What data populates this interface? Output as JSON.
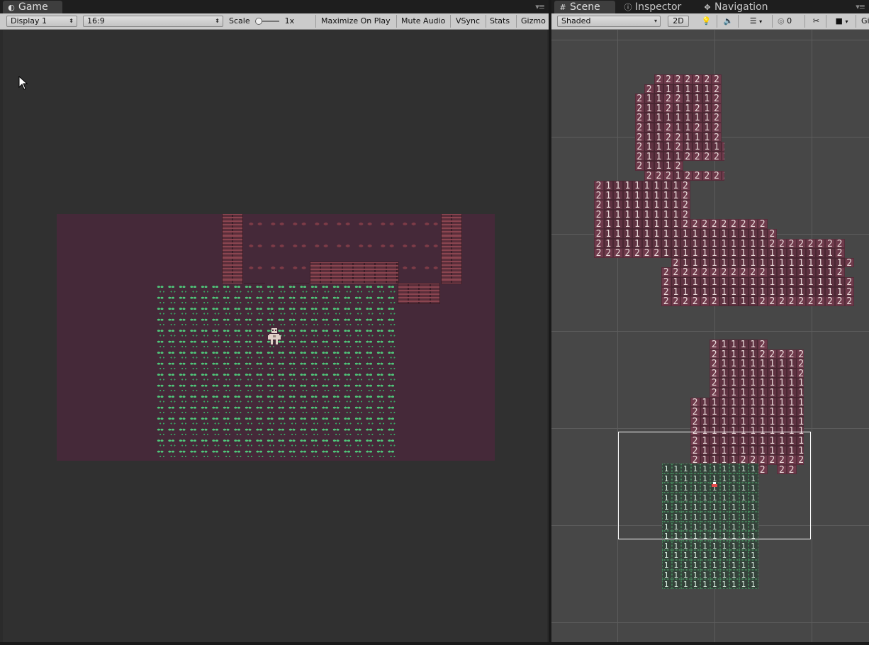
{
  "game_panel": {
    "tab_label": "Game",
    "toolbar": {
      "display": "Display 1",
      "aspect": "16:9",
      "scale_label": "Scale",
      "scale_value": "1x",
      "maximize": "Maximize On Play",
      "mute": "Mute Audio",
      "vsync": "VSync",
      "stats": "Stats",
      "gizmos": "Gizmo"
    }
  },
  "scene_panel": {
    "tabs": [
      {
        "label": "Scene",
        "icon": "hash-icon"
      },
      {
        "label": "Inspector",
        "icon": "info-icon"
      },
      {
        "label": "Navigation",
        "icon": "navigation-icon"
      }
    ],
    "toolbar": {
      "shading": "Shaded",
      "mode_2d": "2D",
      "hidden_count": "0",
      "gizmos": "Gi"
    },
    "map_rows": {
      "room1": [
        "   2222222",
        "  21111112",
        " 211221112",
        " 211211212",
        " 211111112",
        " 211211212",
        " 211221112",
        " 2111211112",
        " 2111122222",
        " 21112",
        "  222122222"
      ],
      "room2": [
        "2111111112",
        "2111111112",
        "2111111112",
        "2111111112",
        "211111111222222222",
        "2111111111111111112",
        "21111111111111111122222222",
        "22222221111111111111111112",
        "        2111111111111111112",
        "       2222222222211111112",
        "       21111111111111111112",
        "       21111111111111111112",
        "       22222211112222222222"
      ],
      "room3": [
        "  211112",
        "  2111122222",
        "  2111111112",
        "  2111111112",
        "  21111111112",
        "  21111111112",
        "2111111111112",
        "2111111111112",
        "2111111111112",
        "2111111111112",
        "2111111111112",
        "2111111111112",
        "2111122222222",
        "  222222 22"
      ],
      "grass": [
        "1111111111",
        "1111111111",
        "1111111111",
        "1111111111",
        "1111111111",
        "1111111111",
        "1111111111",
        "1111111111",
        "1111111111",
        "1111111111",
        "1111111111",
        "1111111111",
        "1111111111"
      ]
    }
  },
  "colors": {
    "room_floor": "#452939",
    "brick": "#7d3b47",
    "grass": "#4fc77a",
    "player": "#e0d0c8",
    "camera_frame": "#ffffff"
  }
}
